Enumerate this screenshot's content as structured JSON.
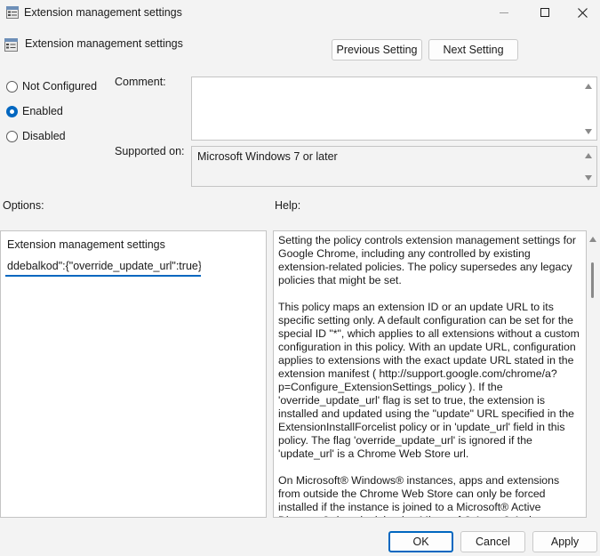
{
  "window": {
    "title": "Extension management settings",
    "icon": "policy-settings-icon"
  },
  "header": {
    "title": "Extension management settings",
    "prev_label": "Previous Setting",
    "next_label": "Next Setting"
  },
  "state": {
    "options": [
      {
        "label": "Not Configured",
        "checked": false
      },
      {
        "label": "Enabled",
        "checked": true
      },
      {
        "label": "Disabled",
        "checked": false
      }
    ]
  },
  "comment": {
    "label": "Comment:",
    "value": ""
  },
  "supported": {
    "label": "Supported on:",
    "value": "Microsoft Windows 7 or later"
  },
  "options": {
    "label": "Options:",
    "pane_title": "Extension management settings",
    "input_value": "ddebalkod\":{\"override_update_url\":true}}"
  },
  "help": {
    "label": "Help:",
    "paragraphs": [
      "Setting the policy controls extension management settings for Google Chrome, including any controlled by existing extension-related policies. The policy supersedes any legacy policies that might be set.",
      "This policy maps an extension ID or an update URL to its specific setting only. A default configuration can be set for the special ID \"*\", which applies to all extensions without a custom configuration in this policy. With an update URL, configuration applies to extensions with the exact update URL stated in the extension manifest ( http://support.google.com/chrome/a?p=Configure_ExtensionSettings_policy ). If the 'override_update_url' flag is set to true, the extension is installed and updated using the \"update\" URL specified in the ExtensionInstallForcelist policy or in 'update_url' field in this policy. The flag 'override_update_url' is ignored if the 'update_url' is a Chrome Web Store url.",
      "On Microsoft® Windows® instances, apps and extensions from outside the Chrome Web Store can only be forced installed if the instance is joined to a Microsoft® Active Directory® domain, joined to Microsoft® Azure® Active Directory® or enrolled in Chrome Browser Cloud Management."
    ]
  },
  "footer": {
    "ok_label": "OK",
    "cancel_label": "Cancel",
    "apply_label": "Apply"
  }
}
